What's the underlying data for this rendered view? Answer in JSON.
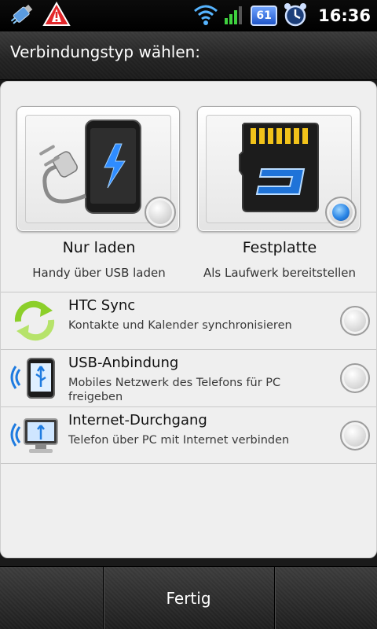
{
  "status_bar": {
    "time": "16:36",
    "battery_level": "61",
    "icons": [
      "usb-debug-icon",
      "warning-icon",
      "wifi-icon",
      "signal-icon",
      "battery-icon",
      "alarm-clock-icon"
    ]
  },
  "header": {
    "title": "Verbindungstyp wählen:"
  },
  "tiles": [
    {
      "label": "Nur laden",
      "sublabel": "Handy über USB laden",
      "icon": "charger-phone-icon",
      "selected": false
    },
    {
      "label": "Festplatte",
      "sublabel": "Als Laufwerk bereitstellen",
      "icon": "sd-card-icon",
      "selected": true
    }
  ],
  "options": [
    {
      "title": "HTC Sync",
      "description": "Kontakte und Kalender synchronisieren",
      "icon": "sync-icon",
      "selected": false
    },
    {
      "title": "USB-Anbindung",
      "description": "Mobiles Netzwerk des Telefons für PC freigeben",
      "icon": "usb-tethering-icon",
      "selected": false
    },
    {
      "title": "Internet-Durchgang",
      "description": "Telefon über PC mit Internet verbinden",
      "icon": "internet-passthrough-icon",
      "selected": false
    }
  ],
  "footer": {
    "done_label": "Fertig"
  },
  "colors": {
    "accent": "#2b86e6",
    "panel_bg": "#efefef",
    "bar_bg": "#222222"
  }
}
